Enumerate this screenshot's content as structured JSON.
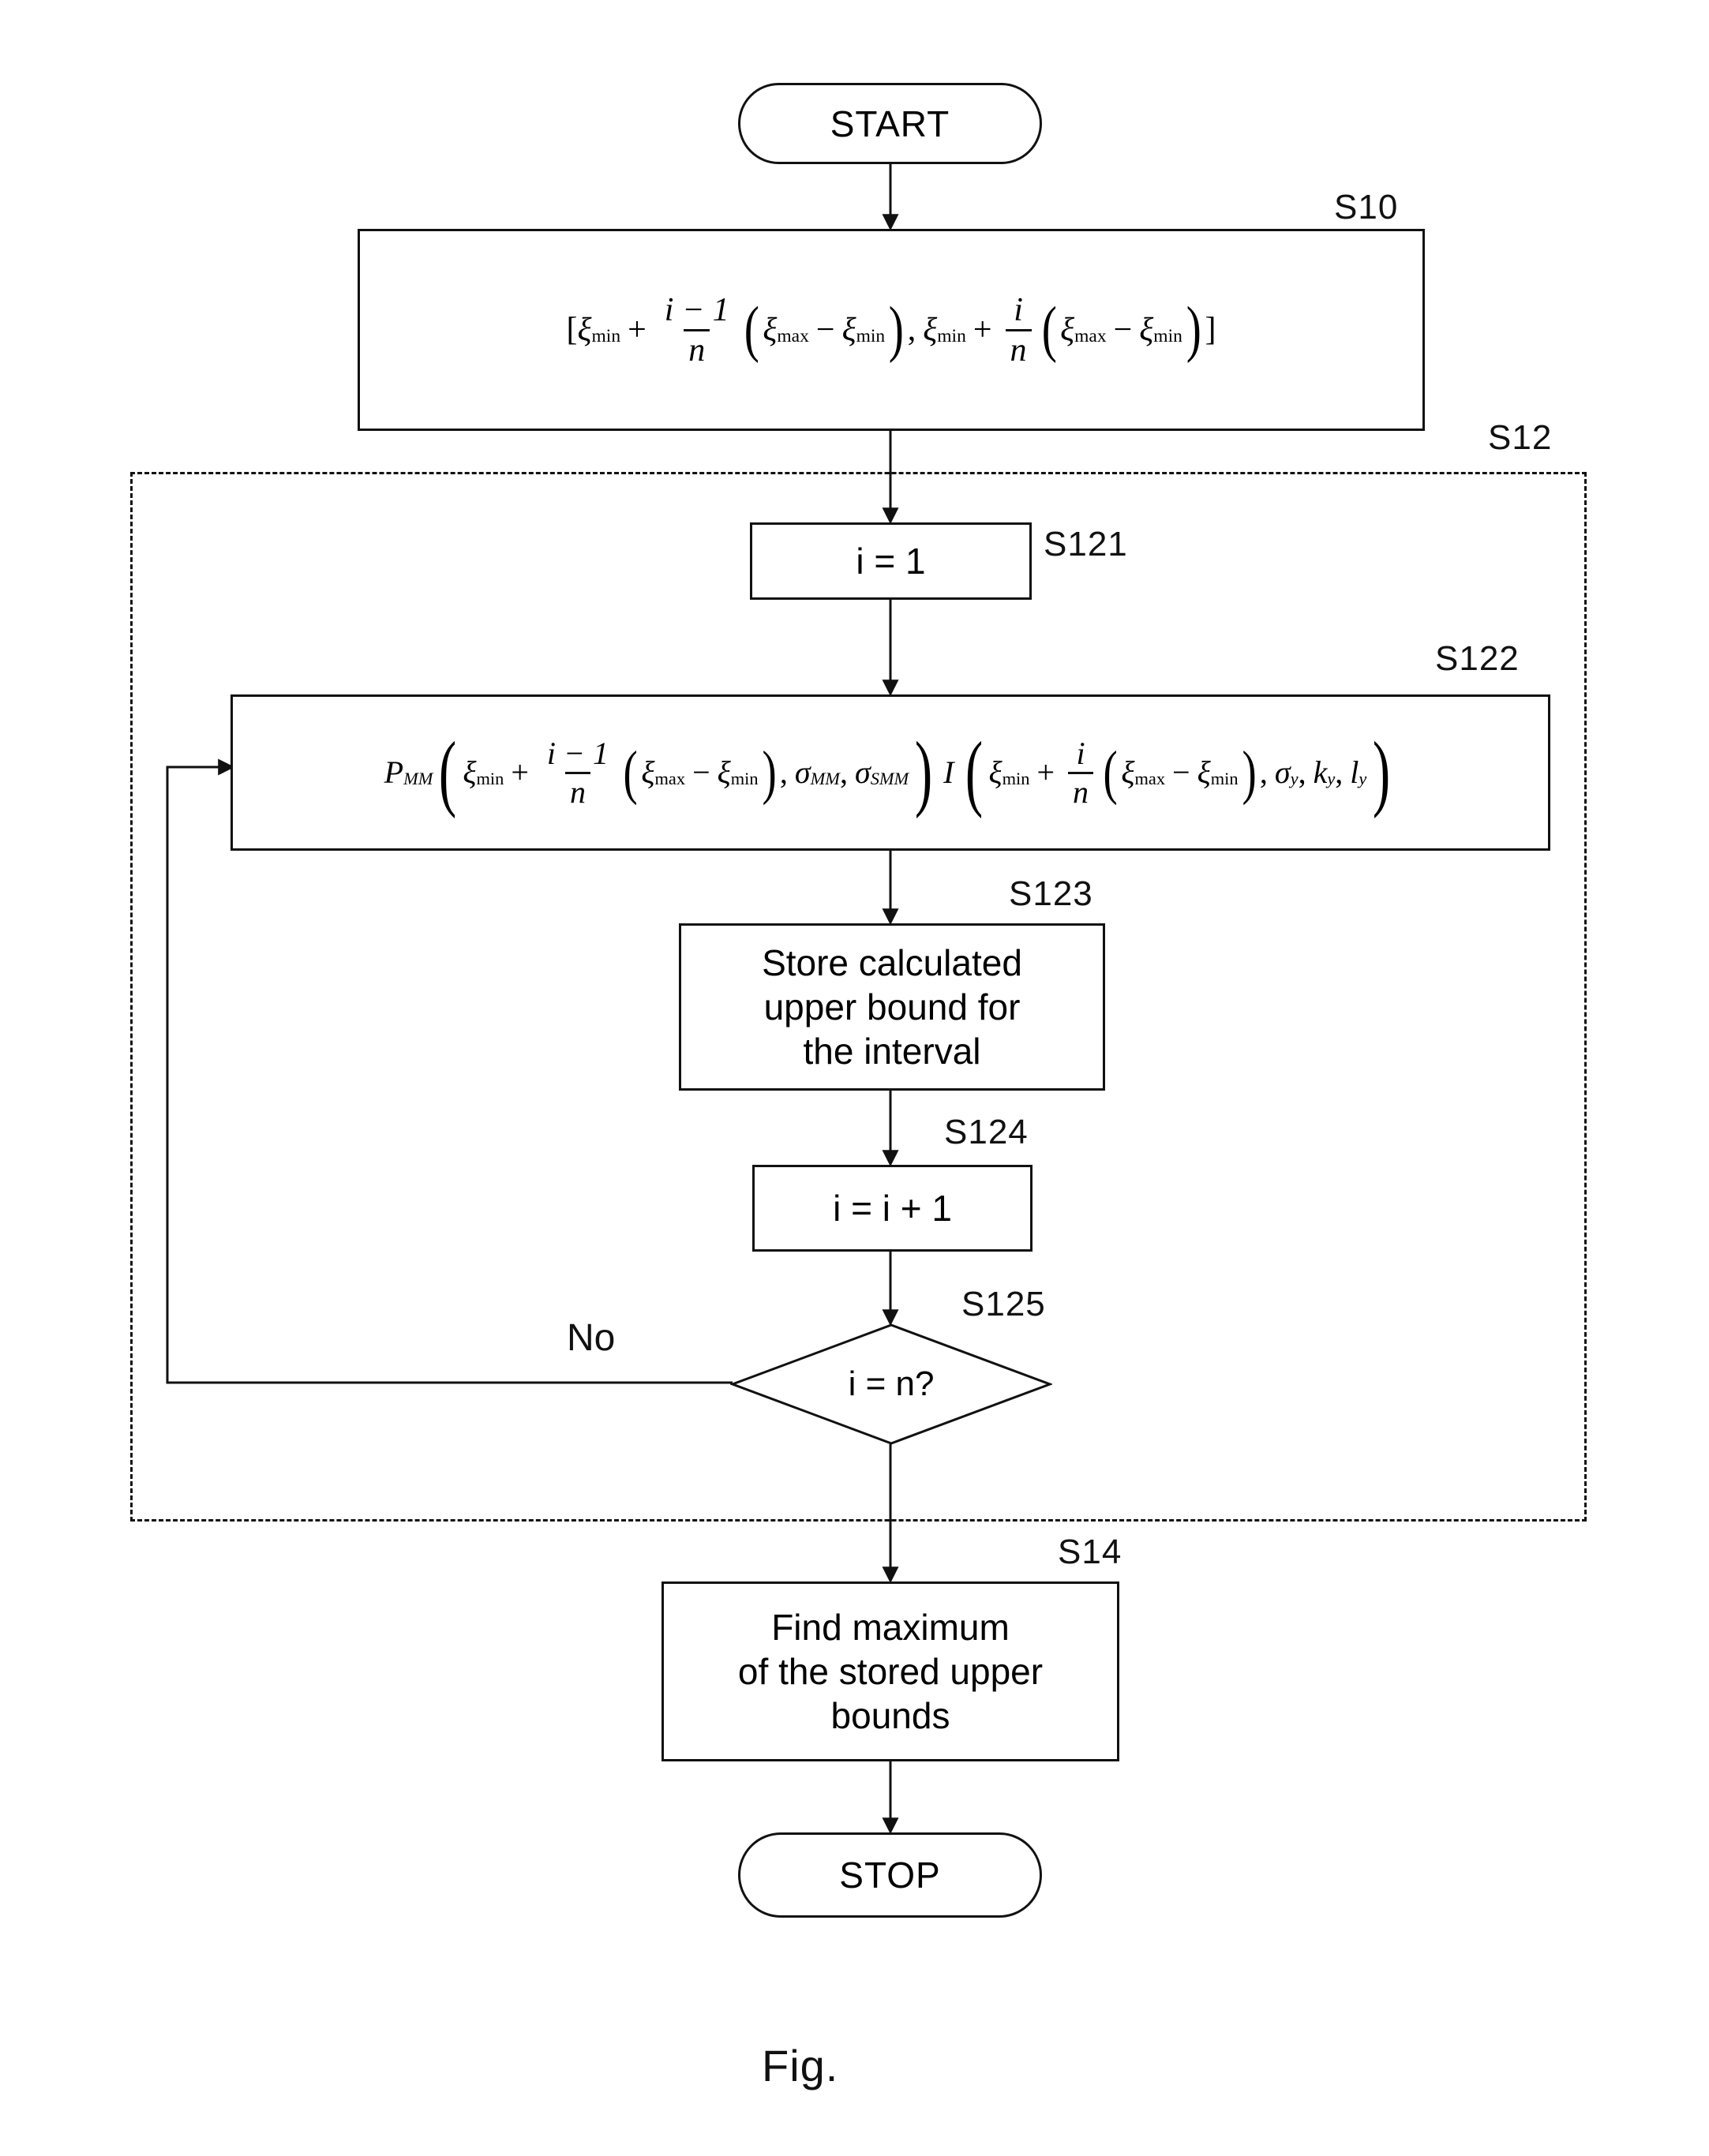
{
  "figure": {
    "caption": "Fig."
  },
  "nodes": {
    "start": {
      "label": "START",
      "step": ""
    },
    "s10": {
      "step": "S10",
      "formula_text": "[ξmin + (i−1)/n (ξmax − ξmin), ξmin + i/n (ξmax − ξmin)]"
    },
    "s12": {
      "step": "S12"
    },
    "s121": {
      "step": "S121",
      "label": "i = 1"
    },
    "s122": {
      "step": "S122",
      "formula_text": "PMM(ξmin + (i−1)/n (ξmax − ξmin), σMM, σSMM) I(ξmin + i/n (ξmax − ξmin), σy, ky, ly)"
    },
    "s123": {
      "step": "S123",
      "line1": "Store calculated",
      "line2": "upper bound for",
      "line3": "the interval"
    },
    "s124": {
      "step": "S124",
      "label": "i = i + 1"
    },
    "s125": {
      "step": "S125",
      "label": "i = n?",
      "branch_no": "No"
    },
    "s14": {
      "step": "S14",
      "line1": "Find maximum",
      "line2": "of the stored upper",
      "line3": "bounds"
    },
    "stop": {
      "label": "STOP"
    }
  },
  "math": {
    "xi": "ξ",
    "sub_min": "min",
    "sub_max": "max",
    "sub_MM": "MM",
    "sub_SMM": "SMM",
    "var_i": "i",
    "var_n": "n",
    "var_P": "P",
    "var_I": "I",
    "sigma": "σ",
    "sub_y": "y",
    "var_k": "k",
    "var_l": "l",
    "plus": "+",
    "minus": "−",
    "one": "1",
    "lbracket": "[",
    "rbracket": "]",
    "lparen": "(",
    "rparen": ")",
    "comma": ","
  },
  "colors": {
    "stroke": "#111111",
    "background": "#ffffff"
  }
}
